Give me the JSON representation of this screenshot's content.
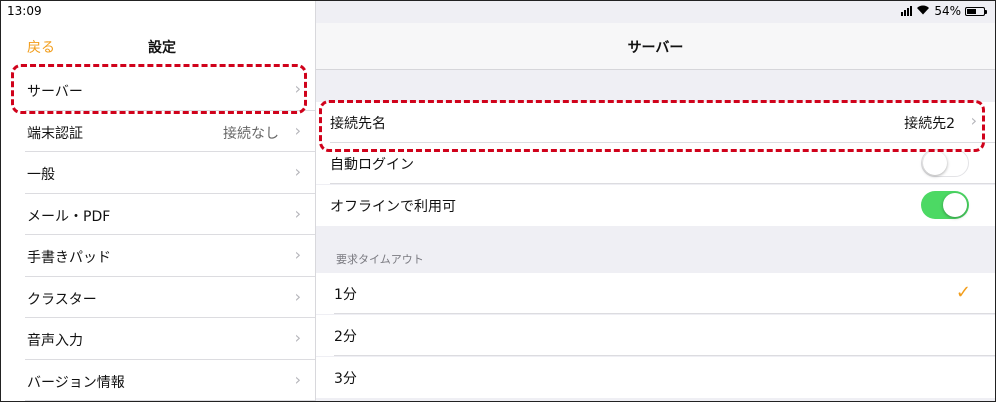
{
  "status": {
    "time": "13:09",
    "battery": "54%"
  },
  "left_panel": {
    "back_label": "戻る",
    "title": "設定",
    "items": [
      {
        "label": "サーバー",
        "value": ""
      },
      {
        "label": "端末認証",
        "value": "接続なし"
      },
      {
        "label": "一般",
        "value": ""
      },
      {
        "label": "メール・PDF",
        "value": ""
      },
      {
        "label": "手書きパッド",
        "value": ""
      },
      {
        "label": "クラスター",
        "value": ""
      },
      {
        "label": "音声入力",
        "value": ""
      },
      {
        "label": "バージョン情報",
        "value": ""
      }
    ]
  },
  "right_panel": {
    "title": "サーバー",
    "connection": {
      "label": "接続先名",
      "value": "接続先2"
    },
    "auto_login": {
      "label": "自動ログイン",
      "enabled": false
    },
    "offline": {
      "label": "オフラインで利用可",
      "enabled": true
    },
    "timeout_section": "要求タイムアウト",
    "timeout_options": [
      "1分",
      "2分",
      "3分"
    ],
    "timeout_selected": "1分"
  },
  "colors": {
    "accent": "#f29d1a",
    "toggle_on": "#4cd964",
    "highlight": "#d0021b"
  }
}
